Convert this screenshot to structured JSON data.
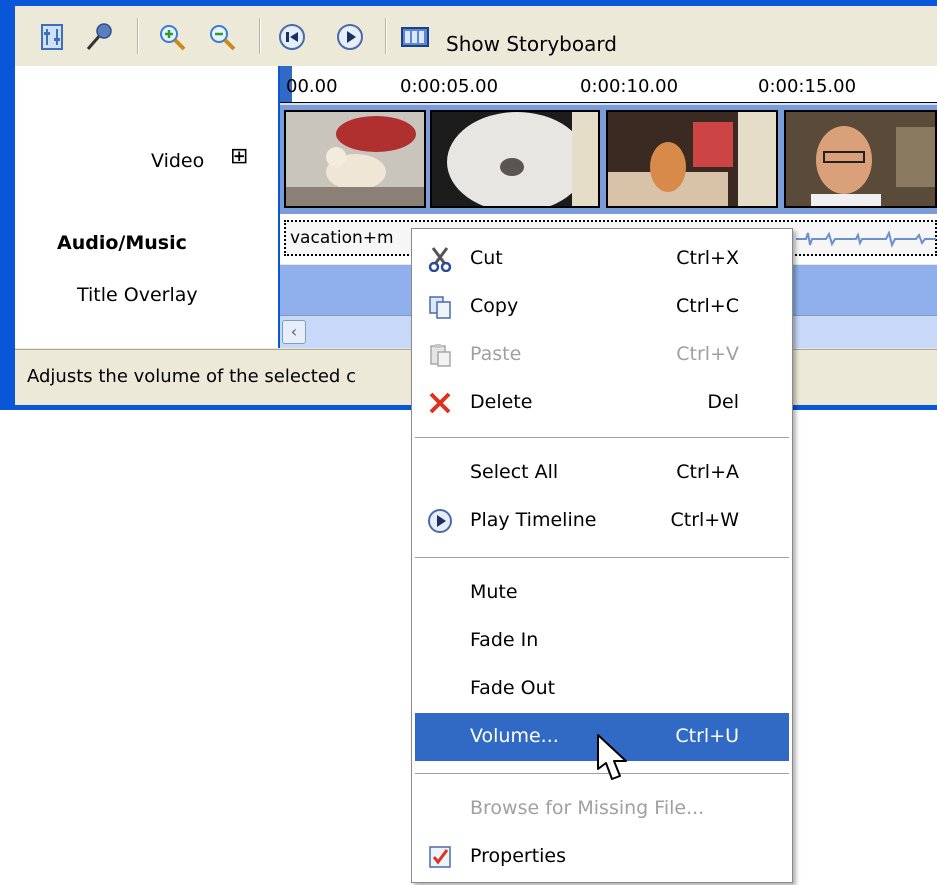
{
  "toolbar": {
    "icons": [
      "set-audio-levels-icon",
      "narrate-timeline-icon",
      "zoom-in-icon",
      "zoom-out-icon",
      "rewind-timeline-icon",
      "play-timeline-icon",
      "storyboard-icon"
    ],
    "show_storyboard_label": "Show Storyboard"
  },
  "ruler": {
    "ticks": [
      "00.00",
      "0:00:05.00",
      "0:00:10.00",
      "0:00:15.00"
    ]
  },
  "tracks": {
    "video_label": "Video",
    "expand_symbol": "⊞",
    "audio_label": "Audio/Music",
    "title_overlay_label": "Title Overlay"
  },
  "audio_clip": {
    "name": "vacation+m"
  },
  "status_bar": {
    "text": "Adjusts the volume of the selected c"
  },
  "context_menu": {
    "items": [
      {
        "label": "Cut",
        "shortcut": "Ctrl+X",
        "icon": "scissors-icon",
        "enabled": true
      },
      {
        "label": "Copy",
        "shortcut": "Ctrl+C",
        "icon": "copy-icon",
        "enabled": true
      },
      {
        "label": "Paste",
        "shortcut": "Ctrl+V",
        "icon": "paste-icon",
        "enabled": false
      },
      {
        "label": "Delete",
        "shortcut": "Del",
        "icon": "delete-x-icon",
        "enabled": true
      },
      {
        "label": "Select All",
        "shortcut": "Ctrl+A",
        "enabled": true
      },
      {
        "label": "Play Timeline",
        "shortcut": "Ctrl+W",
        "icon": "play-icon",
        "enabled": true
      },
      {
        "label": "Mute",
        "shortcut": "",
        "enabled": true
      },
      {
        "label": "Fade In",
        "shortcut": "",
        "enabled": true
      },
      {
        "label": "Fade Out",
        "shortcut": "",
        "enabled": true
      },
      {
        "label": "Volume...",
        "shortcut": "Ctrl+U",
        "enabled": true,
        "highlighted": true
      },
      {
        "label": "Browse for Missing File...",
        "shortcut": "",
        "enabled": false
      },
      {
        "label": "Properties",
        "shortcut": "",
        "icon": "properties-icon",
        "enabled": true
      }
    ]
  },
  "colors": {
    "window_border": "#0a56d8",
    "highlight": "#316ac5",
    "timeline_track": "#8fb0ec"
  }
}
